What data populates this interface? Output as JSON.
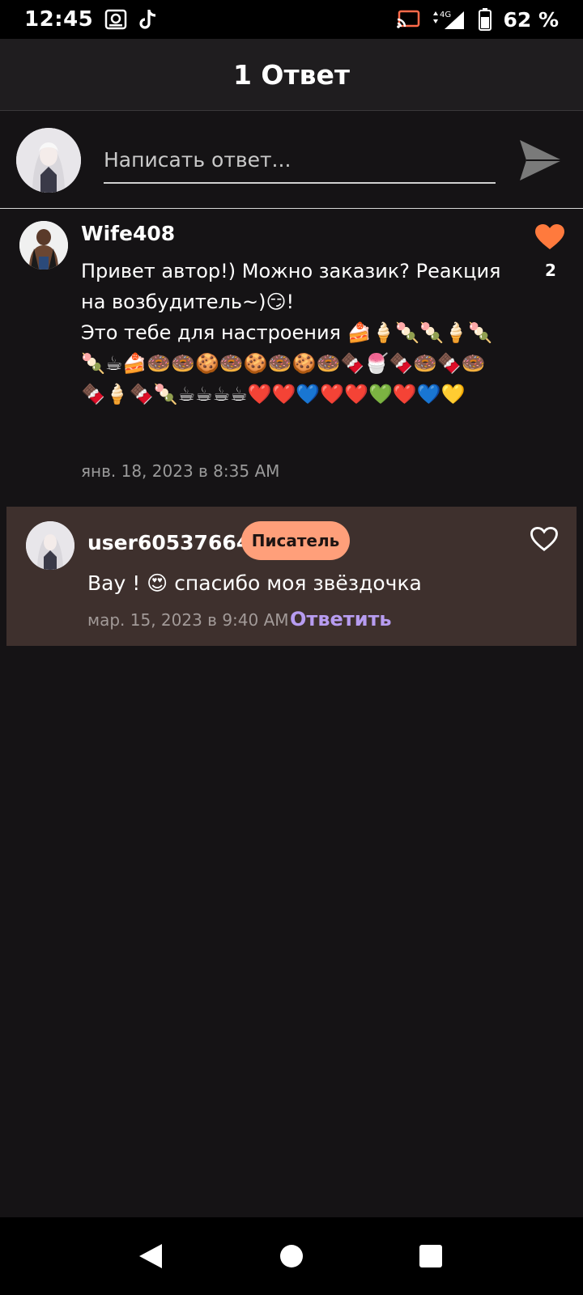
{
  "status_bar": {
    "time": "12:45",
    "battery_percent": "62 %",
    "network": "4G",
    "icons": [
      "gallery-icon",
      "tiktok-icon",
      "cast-icon",
      "signal-icon",
      "battery-icon"
    ]
  },
  "header": {
    "title": "1 Ответ"
  },
  "composer": {
    "placeholder": "Написать ответ...",
    "send_icon": "send-icon"
  },
  "comment": {
    "author": "Wife408",
    "body": "Привет автор!) Можно заказик? Реакция на возбудитель~)😏!\nЭто тебе для настроения 🍰🍦🍡🍡🍦🍡🍡☕🍰🍩🍩🍪🍩🍪🍩🍪🍩🍫🍧🍫🍩🍫🍩🍫🍦🍫🍡☕☕☕☕❤️❤️💙❤️❤️💚❤️💙💛",
    "date": "янв. 18, 2023 в 8:35 AM",
    "likes": "2",
    "liked": true,
    "heart_color": "#ff7a3d"
  },
  "reply": {
    "author": "user60537664",
    "badge": "Писатель",
    "body": "Вау ! 😍 спасибо моя звёздочка",
    "date": "мар. 15, 2023 в 9:40 AM",
    "action": "Ответить",
    "liked": false,
    "background": "#3e302d",
    "badge_color": "#ff9f7a",
    "action_color": "#b79cf0"
  },
  "nav_bar": {
    "back_icon": "back-icon",
    "home_icon": "home-icon",
    "recents_icon": "recents-icon"
  }
}
